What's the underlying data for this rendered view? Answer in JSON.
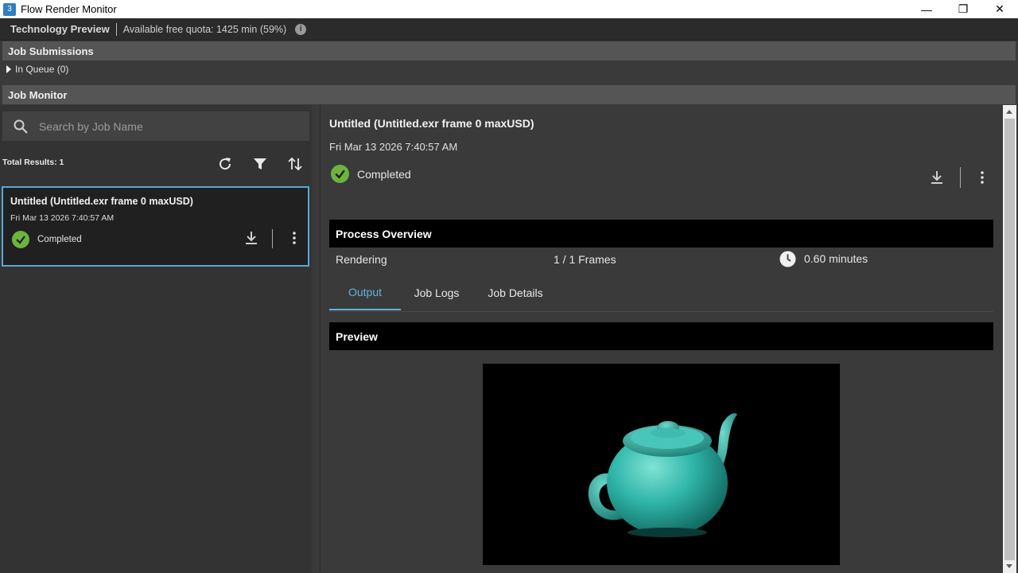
{
  "window": {
    "app_icon_text": "3",
    "title": "Flow Render Monitor",
    "minimize": "—",
    "restore": "❐",
    "close": "✕"
  },
  "techbar": {
    "label": "Technology Preview",
    "quota": "Available free quota: 1425 min (59%)",
    "info_icon": "i"
  },
  "job_submissions": {
    "header": "Job Submissions",
    "queue_label": "In Queue (0)"
  },
  "job_monitor": {
    "header": "Job Monitor",
    "search_placeholder": "Search by Job Name",
    "total_results": "Total Results: 1",
    "jobs": [
      {
        "title": "Untitled (Untitled.exr frame 0 maxUSD)",
        "date": "Fri Mar 13 2026 7:40:57 AM",
        "status": "Completed"
      }
    ]
  },
  "detail": {
    "title": "Untitled (Untitled.exr frame 0 maxUSD)",
    "date": "Fri Mar 13 2026 7:40:57 AM",
    "status": "Completed",
    "process_overview_header": "Process Overview",
    "process_stage": "Rendering",
    "frames": "1 / 1 Frames",
    "duration": "0.60 minutes",
    "tabs": [
      "Output",
      "Job Logs",
      "Job Details"
    ],
    "active_tab": "Output",
    "preview_header": "Preview"
  },
  "colors": {
    "accent": "#5fb3df",
    "success": "#6db33f",
    "teapot": "#2fb5a8"
  }
}
